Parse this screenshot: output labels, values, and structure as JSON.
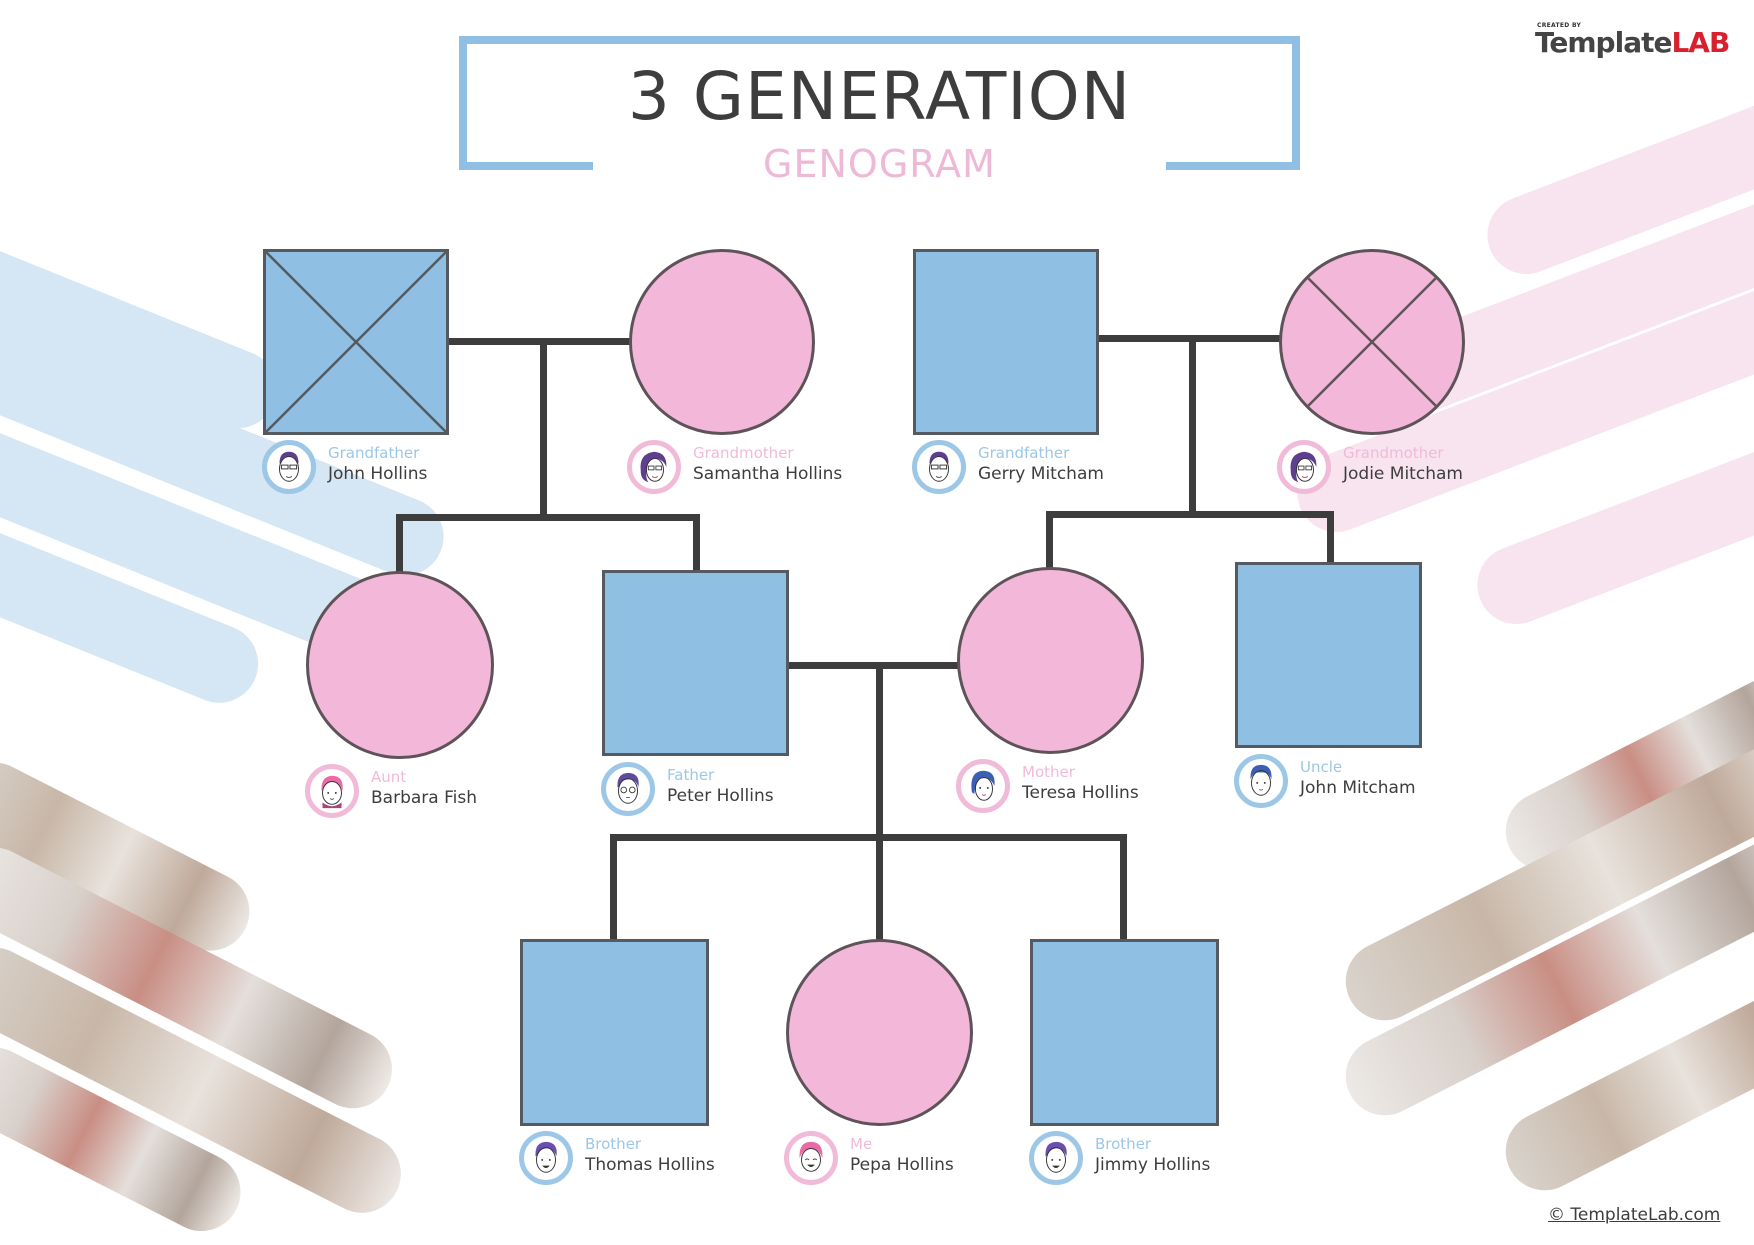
{
  "title": {
    "main": "3 GENERATION",
    "sub": "GENOGRAM"
  },
  "logo": {
    "created_by": "CREATED BY",
    "template": "Template",
    "lab": "LAB"
  },
  "colors": {
    "male": "#8fbfe3",
    "female": "#f3b8d9",
    "line": "#3d3d3d",
    "title_text": "#3d3d3d",
    "subtitle_text": "#eeb8d7",
    "logo_red": "#d8212f"
  },
  "legend_meaning": {
    "square": "male",
    "circle": "female",
    "x_mark": "deceased"
  },
  "people": {
    "grandfather_paternal": {
      "role": "Grandfather",
      "name": "John Hollins",
      "sex": "male",
      "deceased": true
    },
    "grandmother_paternal": {
      "role": "Grandmother",
      "name": "Samantha Hollins",
      "sex": "female",
      "deceased": false
    },
    "grandfather_maternal": {
      "role": "Grandfather",
      "name": "Gerry Mitcham",
      "sex": "male",
      "deceased": false
    },
    "grandmother_maternal": {
      "role": "Grandmother",
      "name": "Jodie Mitcham",
      "sex": "female",
      "deceased": true
    },
    "aunt": {
      "role": "Aunt",
      "name": "Barbara Fish",
      "sex": "female",
      "deceased": false
    },
    "father": {
      "role": "Father",
      "name": "Peter Hollins",
      "sex": "male",
      "deceased": false
    },
    "mother": {
      "role": "Mother",
      "name": "Teresa Hollins",
      "sex": "female",
      "deceased": false
    },
    "uncle": {
      "role": "Uncle",
      "name": "John Mitcham",
      "sex": "male",
      "deceased": false
    },
    "brother1": {
      "role": "Brother",
      "name": "Thomas Hollins",
      "sex": "male",
      "deceased": false
    },
    "me": {
      "role": "Me",
      "name": "Pepa Hollins",
      "sex": "female",
      "deceased": false
    },
    "brother2": {
      "role": "Brother",
      "name": "Jimmy Hollins",
      "sex": "male",
      "deceased": false
    }
  },
  "relationships": [
    {
      "type": "marriage",
      "partners": [
        "John Hollins",
        "Samantha Hollins"
      ],
      "children": [
        "Barbara Fish",
        "Peter Hollins"
      ]
    },
    {
      "type": "marriage",
      "partners": [
        "Gerry Mitcham",
        "Jodie Mitcham"
      ],
      "children": [
        "Teresa Hollins",
        "John Mitcham"
      ]
    },
    {
      "type": "marriage",
      "partners": [
        "Peter Hollins",
        "Teresa Hollins"
      ],
      "children": [
        "Thomas Hollins",
        "Pepa Hollins",
        "Jimmy Hollins"
      ]
    }
  ],
  "footer": {
    "copyright": "© TemplateLab.com"
  }
}
